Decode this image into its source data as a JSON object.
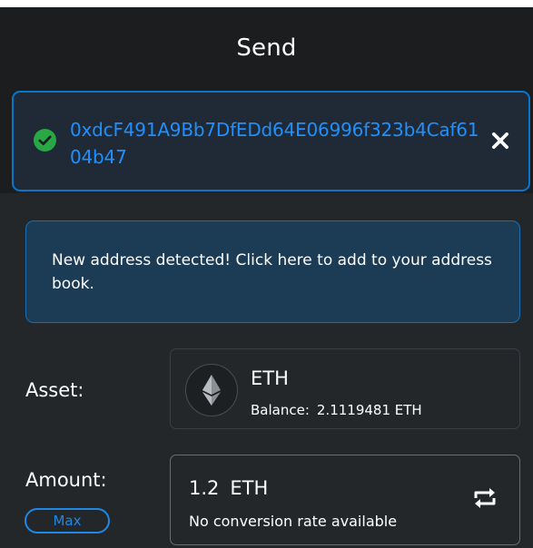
{
  "header": {
    "title": "Send",
    "recipient_address": "0xdcF491A9Bb7DfEDd64E06996f323b4Caf6104b47",
    "check_icon": "check-circle-icon",
    "close_icon": "close-icon"
  },
  "banner": {
    "text": "New address detected! Click here to add to your address book."
  },
  "asset": {
    "label": "Asset:",
    "symbol": "ETH",
    "balance_label": "Balance:",
    "balance_value": "2.1119481 ETH",
    "icon": "ethereum-icon"
  },
  "amount": {
    "label": "Amount:",
    "value": "1.2",
    "unit": "ETH",
    "conversion": "No conversion rate available",
    "max_label": "Max",
    "swap_icon": "swap-icon"
  },
  "colors": {
    "accent": "#1e90ff",
    "success": "#28a745",
    "banner_bg": "#1c3b54",
    "background": "#24272a"
  }
}
